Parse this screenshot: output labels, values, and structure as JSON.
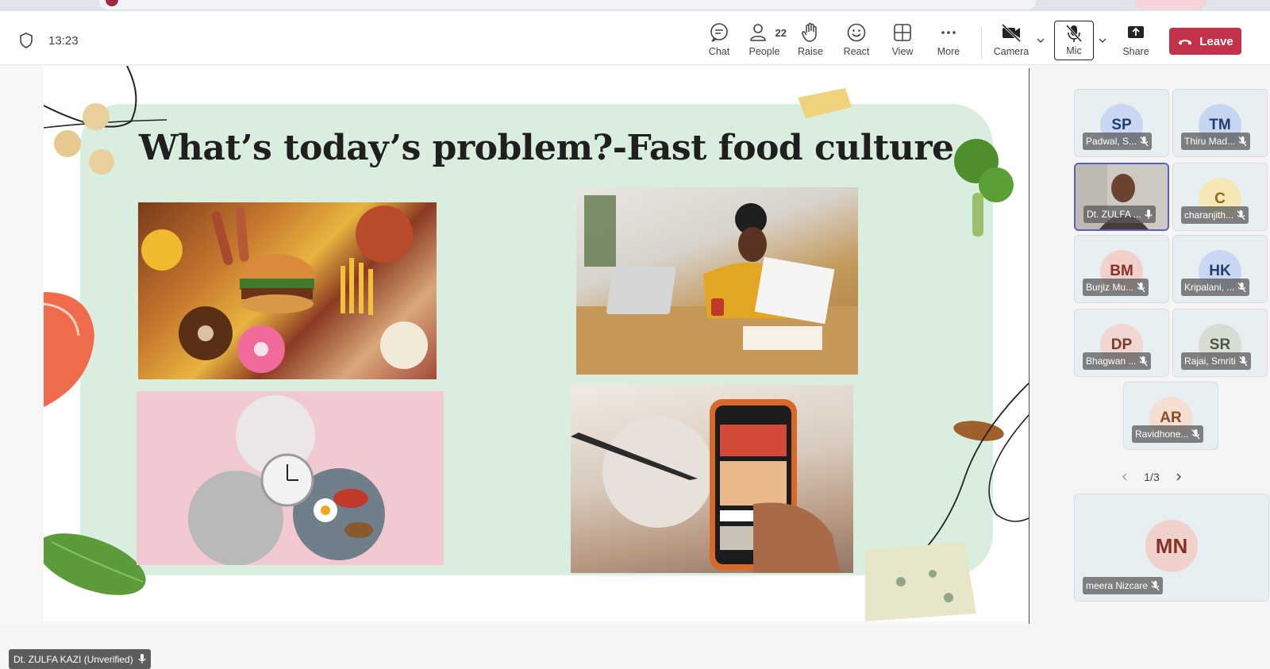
{
  "toolbar": {
    "timer": "13:23",
    "chat": "Chat",
    "people": "People",
    "people_count": "22",
    "raise": "Raise",
    "react": "React",
    "view": "View",
    "more": "More",
    "camera": "Camera",
    "mic": "Mic",
    "share": "Share",
    "leave": "Leave"
  },
  "slide": {
    "title": "What’s today’s problem?-Fast food culture",
    "presenter": "Dt. ZULFA KAZI (Unverified)"
  },
  "participants": [
    {
      "initials": "SP",
      "name": "Padwal, S...",
      "bg": "#c9d7f3",
      "fg": "#243a73"
    },
    {
      "initials": "TM",
      "name": "Thiru Mad...",
      "bg": "#c6d6f0",
      "fg": "#243a73"
    },
    {
      "initials": "",
      "name": "Dt. ZULFA ...",
      "bg": "#b9b2ad",
      "fg": "#ffffff"
    },
    {
      "initials": "C",
      "name": "charanjith...",
      "bg": "#f6e7b6",
      "fg": "#8a6d10"
    },
    {
      "initials": "BM",
      "name": "Burjiz Mu...",
      "bg": "#f2d1cc",
      "fg": "#8a2f23"
    },
    {
      "initials": "HK",
      "name": "Kripalani, ...",
      "bg": "#c9d7f3",
      "fg": "#243a73"
    },
    {
      "initials": "DP",
      "name": "Bhagwan ...",
      "bg": "#f1d7d1",
      "fg": "#7d3a2c"
    },
    {
      "initials": "SR",
      "name": "Rajai, Smriti",
      "bg": "#d8ddd3",
      "fg": "#4b5a3e"
    },
    {
      "initials": "AR",
      "name": "Ravidhone...",
      "bg": "#f5dfd2",
      "fg": "#8a4a26"
    }
  ],
  "pager": "1/3",
  "big_participant": {
    "initials": "MN",
    "name": "meera Nizcare",
    "bg": "#f1d1cc",
    "fg": "#8a2f23"
  },
  "colors": {
    "leave": "#c4314b",
    "active_border": "#5b5fc7",
    "slide_panel": "#d9eedf"
  }
}
